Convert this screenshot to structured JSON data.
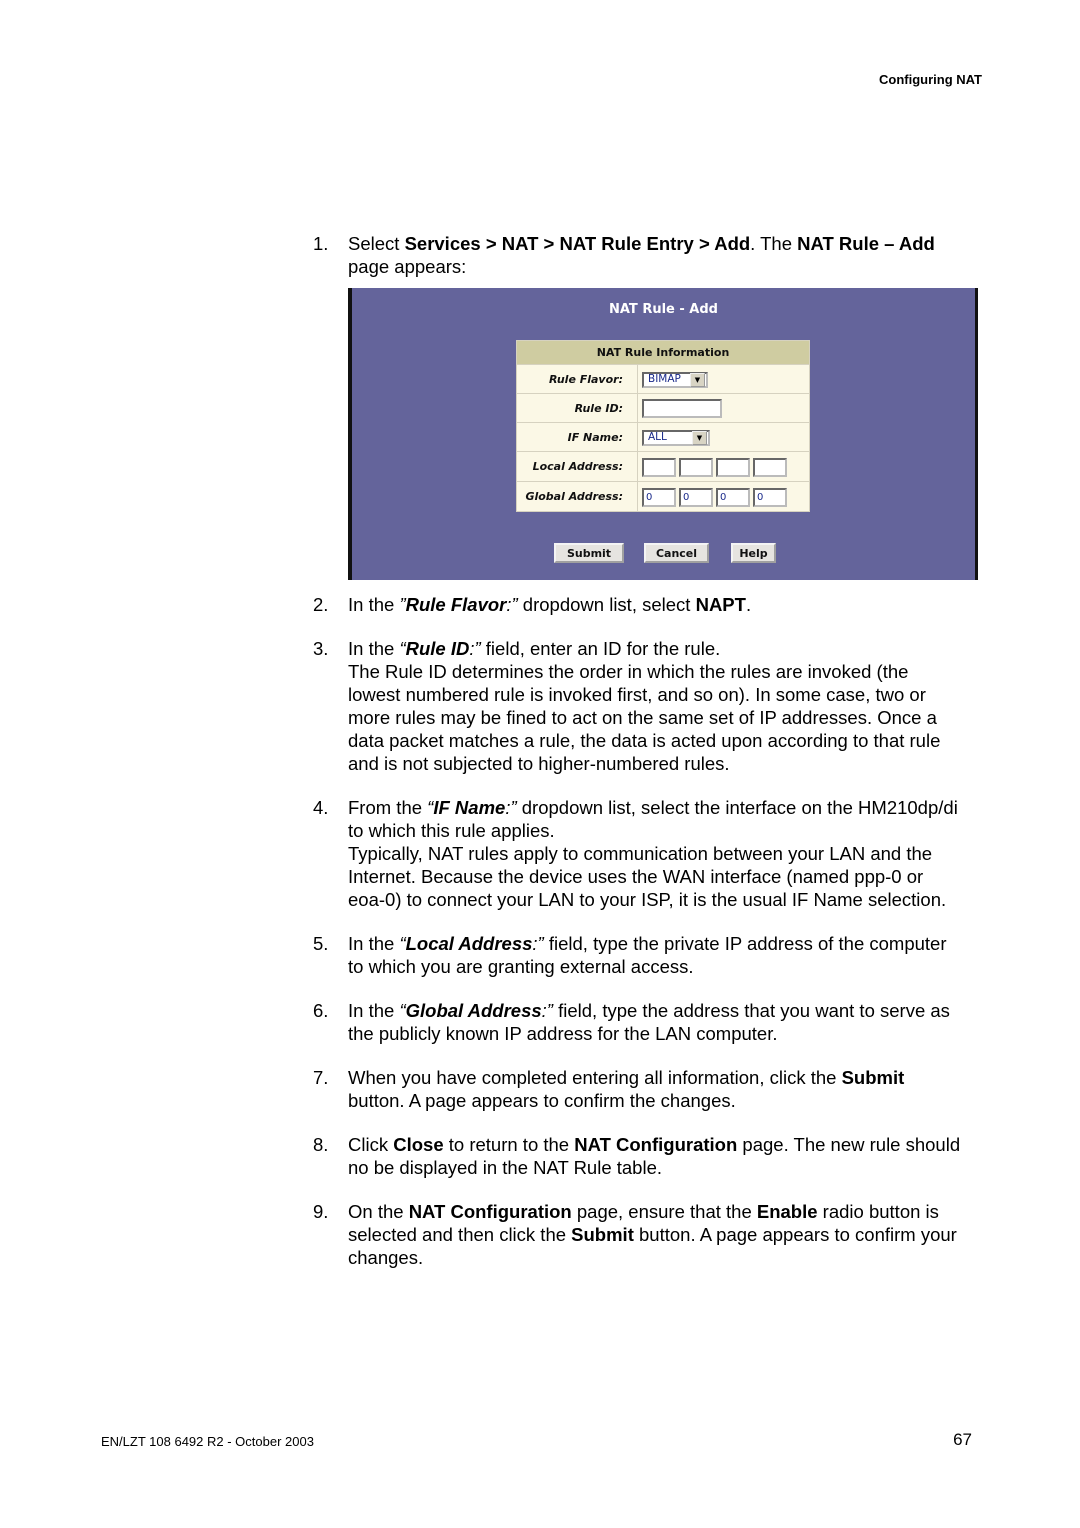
{
  "header": {
    "section": "Configuring NAT"
  },
  "screenshot": {
    "title": "NAT Rule - Add",
    "table_header": "NAT Rule Information",
    "fields": {
      "rule_flavor": {
        "label": "Rule Flavor:",
        "value": "BIMAP",
        "icon": "dropdown-arrow-icon"
      },
      "rule_id": {
        "label": "Rule ID:",
        "value": ""
      },
      "if_name": {
        "label": "IF Name:",
        "value": "ALL",
        "icon": "dropdown-arrow-icon"
      },
      "local_address": {
        "label": "Local Address:",
        "octets": [
          "",
          "",
          "",
          ""
        ]
      },
      "global_address": {
        "label": "Global Address:",
        "octets": [
          "0",
          "0",
          "0",
          "0"
        ]
      }
    },
    "buttons": {
      "submit": "Submit",
      "cancel": "Cancel",
      "help": "Help"
    }
  },
  "steps": [
    {
      "num": "1.",
      "parts": [
        "Select ",
        "Services > NAT > NAT Rule Entry > Add",
        ". The ",
        "NAT Rule – Add",
        " page appears:"
      ]
    },
    {
      "num": "2.",
      "parts": [
        "In the ",
        "”",
        "Rule Flavor",
        ":”",
        " dropdown list, select ",
        "NAPT",
        "."
      ]
    },
    {
      "num": "3.",
      "parts": [
        "In the ",
        "“",
        "Rule ID",
        ":”",
        " field, enter an ID for the rule."
      ],
      "detail": "The Rule ID determines the order in which the rules are invoked (the lowest numbered rule is invoked first, and so on). In some case, two or more rules may be fined to act on the same set of IP addresses. Once a data packet matches a rule, the data is acted upon according to that rule and is not subjected to higher-numbered rules."
    },
    {
      "num": "4.",
      "parts": [
        "From the ",
        "“",
        "IF Name",
        ":”",
        " dropdown list, select the interface on the HM210dp/di to which this rule applies."
      ],
      "detail": "Typically, NAT rules apply to communication between your LAN and the Internet. Because the device uses the WAN interface (named ppp-0 or eoa-0) to connect your LAN to your ISP, it is the usual IF Name selection."
    },
    {
      "num": "5.",
      "parts": [
        "In the ",
        "“",
        "Local Address",
        ":”",
        " field, type the private IP address of the computer to which you are granting external access."
      ]
    },
    {
      "num": "6.",
      "parts": [
        "In the ",
        "“",
        "Global Address",
        ":”",
        " field, type the address that you want to serve as the publicly known IP address for the LAN computer."
      ]
    },
    {
      "num": "7.",
      "parts": [
        "When you have completed entering all information, click the ",
        "Submit",
        " button. A page appears to confirm the changes."
      ]
    },
    {
      "num": "8.",
      "parts": [
        "Click ",
        "Close",
        " to return to the ",
        "NAT Configuration",
        " page. The new rule should no be displayed in the NAT Rule table."
      ]
    },
    {
      "num": "9.",
      "parts": [
        "On the ",
        "NAT Configuration",
        " page, ensure that the ",
        "Enable",
        " radio button is selected and then click the ",
        "Submit",
        " button. A page appears to confirm your changes."
      ]
    }
  ],
  "footer": {
    "doc_id": "EN/LZT 108 6492 R2 - October 2003",
    "page_number": "67"
  }
}
